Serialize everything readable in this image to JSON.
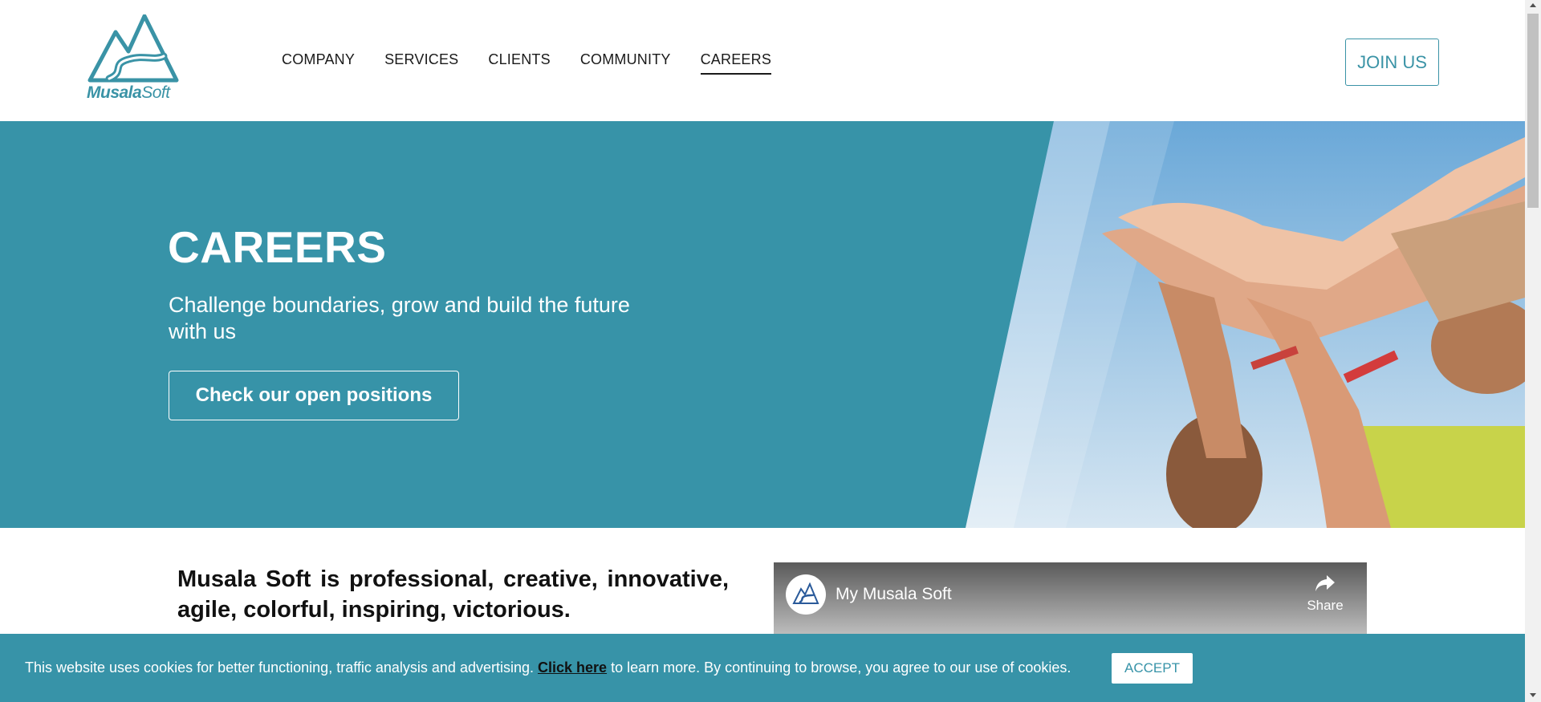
{
  "logo": {
    "brand_bold": "Musala",
    "brand_light": "Soft"
  },
  "nav": {
    "items": [
      {
        "label": "COMPANY",
        "active": false
      },
      {
        "label": "SERVICES",
        "active": false
      },
      {
        "label": "CLIENTS",
        "active": false
      },
      {
        "label": "COMMUNITY",
        "active": false
      },
      {
        "label": "CAREERS",
        "active": true
      }
    ],
    "join_label": "JOIN US"
  },
  "hero": {
    "title": "CAREERS",
    "subtitle": "Challenge boundaries, grow and build the future with us",
    "button_label": "Check our open positions",
    "image_icon": "team-hands-photo"
  },
  "intro": {
    "line1": "Musala Soft is professional, creative, innovative,",
    "line2": "agile, colorful, inspiring, victorious."
  },
  "video": {
    "title": "My Musala Soft",
    "share_label": "Share",
    "channel_icon": "musala-logo-avatar"
  },
  "cookie": {
    "text_before": "This website uses cookies for better functioning, traffic analysis and advertising.",
    "link_label": "Click here",
    "text_after": "to learn more. By continuing to browse, you agree to our use of cookies.",
    "accept_label": "ACCEPT"
  },
  "colors": {
    "brand": "#3793a8",
    "text": "#1a1a1a"
  }
}
